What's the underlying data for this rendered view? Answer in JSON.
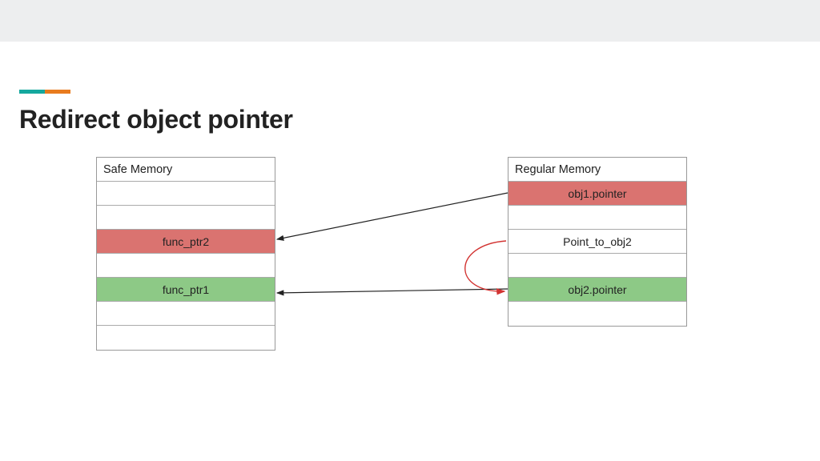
{
  "title": "Redirect object pointer",
  "left_table": {
    "header": "Safe Memory",
    "rows": [
      "",
      "",
      "func_ptr2",
      "",
      "func_ptr1",
      "",
      ""
    ],
    "row_colors": [
      "",
      "",
      "red",
      "",
      "green",
      "",
      ""
    ]
  },
  "right_table": {
    "header": "Regular Memory",
    "rows": [
      "obj1.pointer",
      "",
      "Point_to_obj2",
      "",
      "obj2.pointer",
      ""
    ],
    "row_colors": [
      "red",
      "",
      "",
      "",
      "green",
      ""
    ]
  },
  "arrows": [
    {
      "from": "obj1.pointer",
      "to": "func_ptr2",
      "color": "black"
    },
    {
      "from": "obj2.pointer",
      "to": "func_ptr1",
      "color": "black"
    },
    {
      "from": "Point_to_obj2",
      "to": "obj2.pointer",
      "color": "red",
      "curved": true
    }
  ]
}
